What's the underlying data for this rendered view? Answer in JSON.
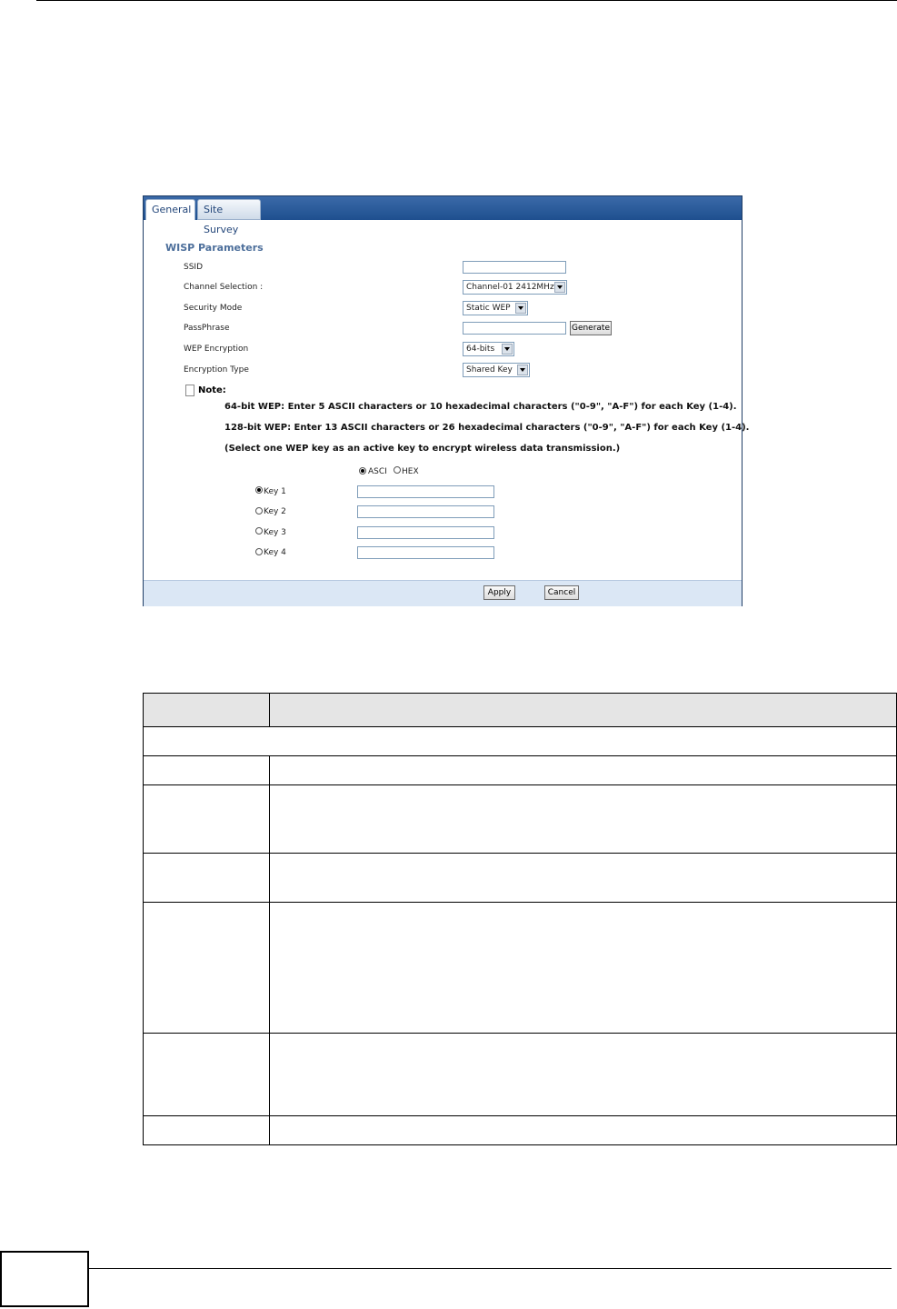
{
  "tabs": [
    "General",
    "Site Survey"
  ],
  "section_title": "WISP Parameters",
  "fields": {
    "ssid_label": "SSID",
    "ssid_value": "",
    "channel_label": "Channel Selection :",
    "channel_value": "Channel-01 2412MHz",
    "security_label": "Security Mode",
    "security_value": "Static WEP",
    "passphrase_label": "PassPhrase",
    "passphrase_value": "",
    "generate_label": "Generate",
    "wep_label": "WEP Encryption",
    "wep_value": "64-bits",
    "enc_type_label": "Encryption Type",
    "enc_type_value": "Shared Key"
  },
  "note": {
    "label": "Note:",
    "lines": [
      "64-bit WEP: Enter 5 ASCII characters or 10 hexadecimal characters (\"0-9\", \"A-F\") for each Key (1-4).",
      "128-bit WEP: Enter 13 ASCII characters or 26 hexadecimal characters (\"0-9\", \"A-F\") for each Key (1-4).",
      "(Select one WEP key as an active key to encrypt wireless data transmission.)"
    ]
  },
  "key_format": {
    "ascii": "ASCI",
    "hex": "HEX",
    "selected": "ascii"
  },
  "keys": [
    {
      "label": "Key 1",
      "selected": true,
      "value": ""
    },
    {
      "label": "Key 2",
      "selected": false,
      "value": ""
    },
    {
      "label": "Key 3",
      "selected": false,
      "value": ""
    },
    {
      "label": "Key 4",
      "selected": false,
      "value": ""
    }
  ],
  "buttons": {
    "apply": "Apply",
    "cancel": "Cancel"
  }
}
